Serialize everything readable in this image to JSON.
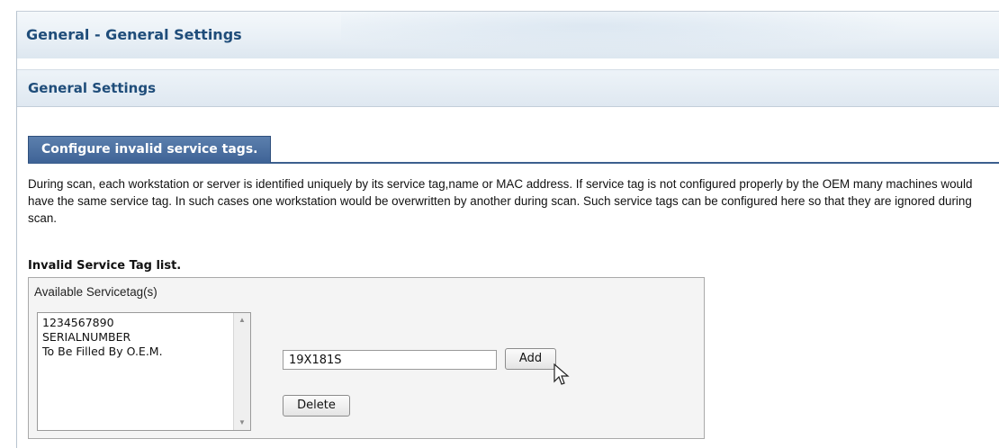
{
  "page": {
    "title": "General - General Settings"
  },
  "section": {
    "title": "General Settings"
  },
  "tab": {
    "label": "Configure invalid service tags."
  },
  "description": "During scan, each workstation or server is identified uniquely by its service tag,name or MAC address. If service tag is not configured properly by the OEM many machines would have the same service tag. In such cases one workstation would be overwritten by another during scan. Such service tags can be configured here so that they are ignored during scan.",
  "invalid_list": {
    "title": "Invalid Service Tag list.",
    "group_label": "Available Servicetag(s)",
    "items": [
      "1234567890",
      "SERIALNUMBER",
      "To Be Filled By O.E.M."
    ],
    "input_value": "19X181S",
    "add_label": "Add",
    "delete_label": "Delete"
  },
  "icons": {
    "scroll_up": "chevron-up-icon",
    "scroll_down": "chevron-down-icon",
    "cursor": "mouse-pointer-icon"
  },
  "colors": {
    "title_blue": "#1f4d7a",
    "tab_blue": "#3e6396"
  }
}
